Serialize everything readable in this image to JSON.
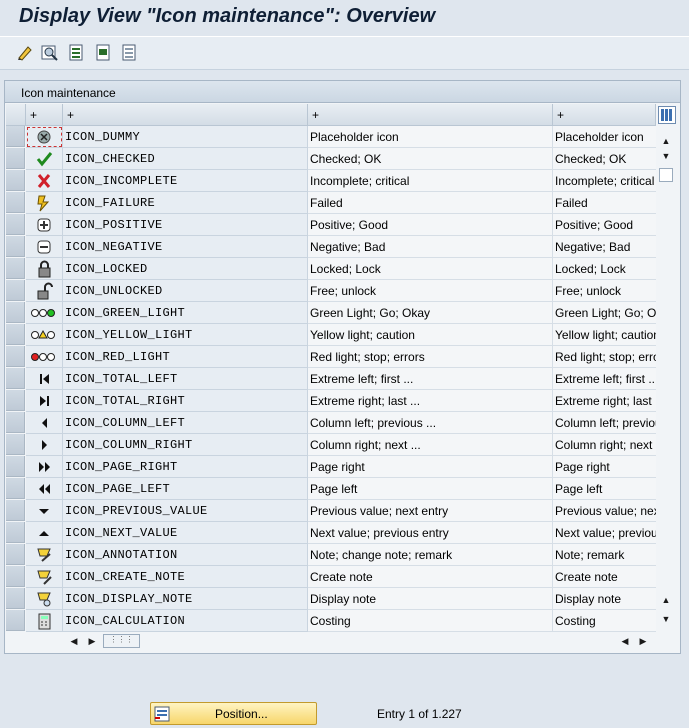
{
  "window": {
    "title": "Display View \"Icon maintenance\": Overview"
  },
  "toolbar": {
    "buttons": [
      {
        "icon": "display-change-icon"
      },
      {
        "icon": "find-icon"
      },
      {
        "icon": "select-all-icon"
      },
      {
        "icon": "select-block-icon"
      },
      {
        "icon": "deselect-all-icon"
      }
    ]
  },
  "panel": {
    "title": "Icon maintenance"
  },
  "table": {
    "headers": [
      "+",
      "+",
      "+",
      "+"
    ],
    "rows": [
      {
        "icon": "placeholder-icon",
        "name": "ICON_DUMMY",
        "text": "Placeholder icon",
        "text2": "Placeholder icon"
      },
      {
        "icon": "checked-icon",
        "name": "ICON_CHECKED",
        "text": "Checked; OK",
        "text2": "Checked; OK"
      },
      {
        "icon": "incomplete-icon",
        "name": "ICON_INCOMPLETE",
        "text": "Incomplete; critical",
        "text2": "Incomplete; critical"
      },
      {
        "icon": "failure-icon",
        "name": "ICON_FAILURE",
        "text": "Failed",
        "text2": "Failed"
      },
      {
        "icon": "positive-icon",
        "name": "ICON_POSITIVE",
        "text": "Positive; Good",
        "text2": "Positive; Good"
      },
      {
        "icon": "negative-icon",
        "name": "ICON_NEGATIVE",
        "text": "Negative; Bad",
        "text2": "Negative; Bad"
      },
      {
        "icon": "locked-icon",
        "name": "ICON_LOCKED",
        "text": "Locked; Lock",
        "text2": "Locked; Lock"
      },
      {
        "icon": "unlocked-icon",
        "name": "ICON_UNLOCKED",
        "text": "Free; unlock",
        "text2": "Free; unlock"
      },
      {
        "icon": "green-light-icon",
        "name": "ICON_GREEN_LIGHT",
        "text": "Green Light; Go; Okay",
        "text2": "Green Light; Go; Okay"
      },
      {
        "icon": "yellow-light-icon",
        "name": "ICON_YELLOW_LIGHT",
        "text": "Yellow light; caution",
        "text2": "Yellow light; caution"
      },
      {
        "icon": "red-light-icon",
        "name": "ICON_RED_LIGHT",
        "text": "Red light; stop; errors",
        "text2": "Red light; stop; errors"
      },
      {
        "icon": "total-left-icon",
        "name": "ICON_TOTAL_LEFT",
        "text": "Extreme left; first ...",
        "text2": "Extreme left; first ..."
      },
      {
        "icon": "total-right-icon",
        "name": "ICON_TOTAL_RIGHT",
        "text": "Extreme right; last ...",
        "text2": "Extreme right; last ..."
      },
      {
        "icon": "column-left-icon",
        "name": "ICON_COLUMN_LEFT",
        "text": "Column left; previous ...",
        "text2": "Column left; previous ..."
      },
      {
        "icon": "column-right-icon",
        "name": "ICON_COLUMN_RIGHT",
        "text": "Column right; next ...",
        "text2": "Column right; next ..."
      },
      {
        "icon": "page-right-icon",
        "name": "ICON_PAGE_RIGHT",
        "text": "Page right",
        "text2": "Page right"
      },
      {
        "icon": "page-left-icon",
        "name": "ICON_PAGE_LEFT",
        "text": "Page left",
        "text2": "Page left"
      },
      {
        "icon": "previous-value-icon",
        "name": "ICON_PREVIOUS_VALUE",
        "text": "Previous value; next entry",
        "text2": "Previous value; next entry"
      },
      {
        "icon": "next-value-icon",
        "name": "ICON_NEXT_VALUE",
        "text": "Next value; previous entry",
        "text2": "Next value; previous entry"
      },
      {
        "icon": "annotation-icon",
        "name": "ICON_ANNOTATION",
        "text": "Note; change note; remark",
        "text2": "Note; remark"
      },
      {
        "icon": "create-note-icon",
        "name": "ICON_CREATE_NOTE",
        "text": "Create note",
        "text2": "Create note"
      },
      {
        "icon": "display-note-icon",
        "name": "ICON_DISPLAY_NOTE",
        "text": "Display note",
        "text2": "Display note"
      },
      {
        "icon": "calculation-icon",
        "name": "ICON_CALCULATION",
        "text": "Costing",
        "text2": "Costing"
      }
    ]
  },
  "footer": {
    "position_button": "Position...",
    "entry_status": "Entry 1 of 1.227"
  },
  "colors": {
    "title_text": "#0f1f35",
    "button_fill": "#f7d66b",
    "background": "#dfe6ee"
  }
}
